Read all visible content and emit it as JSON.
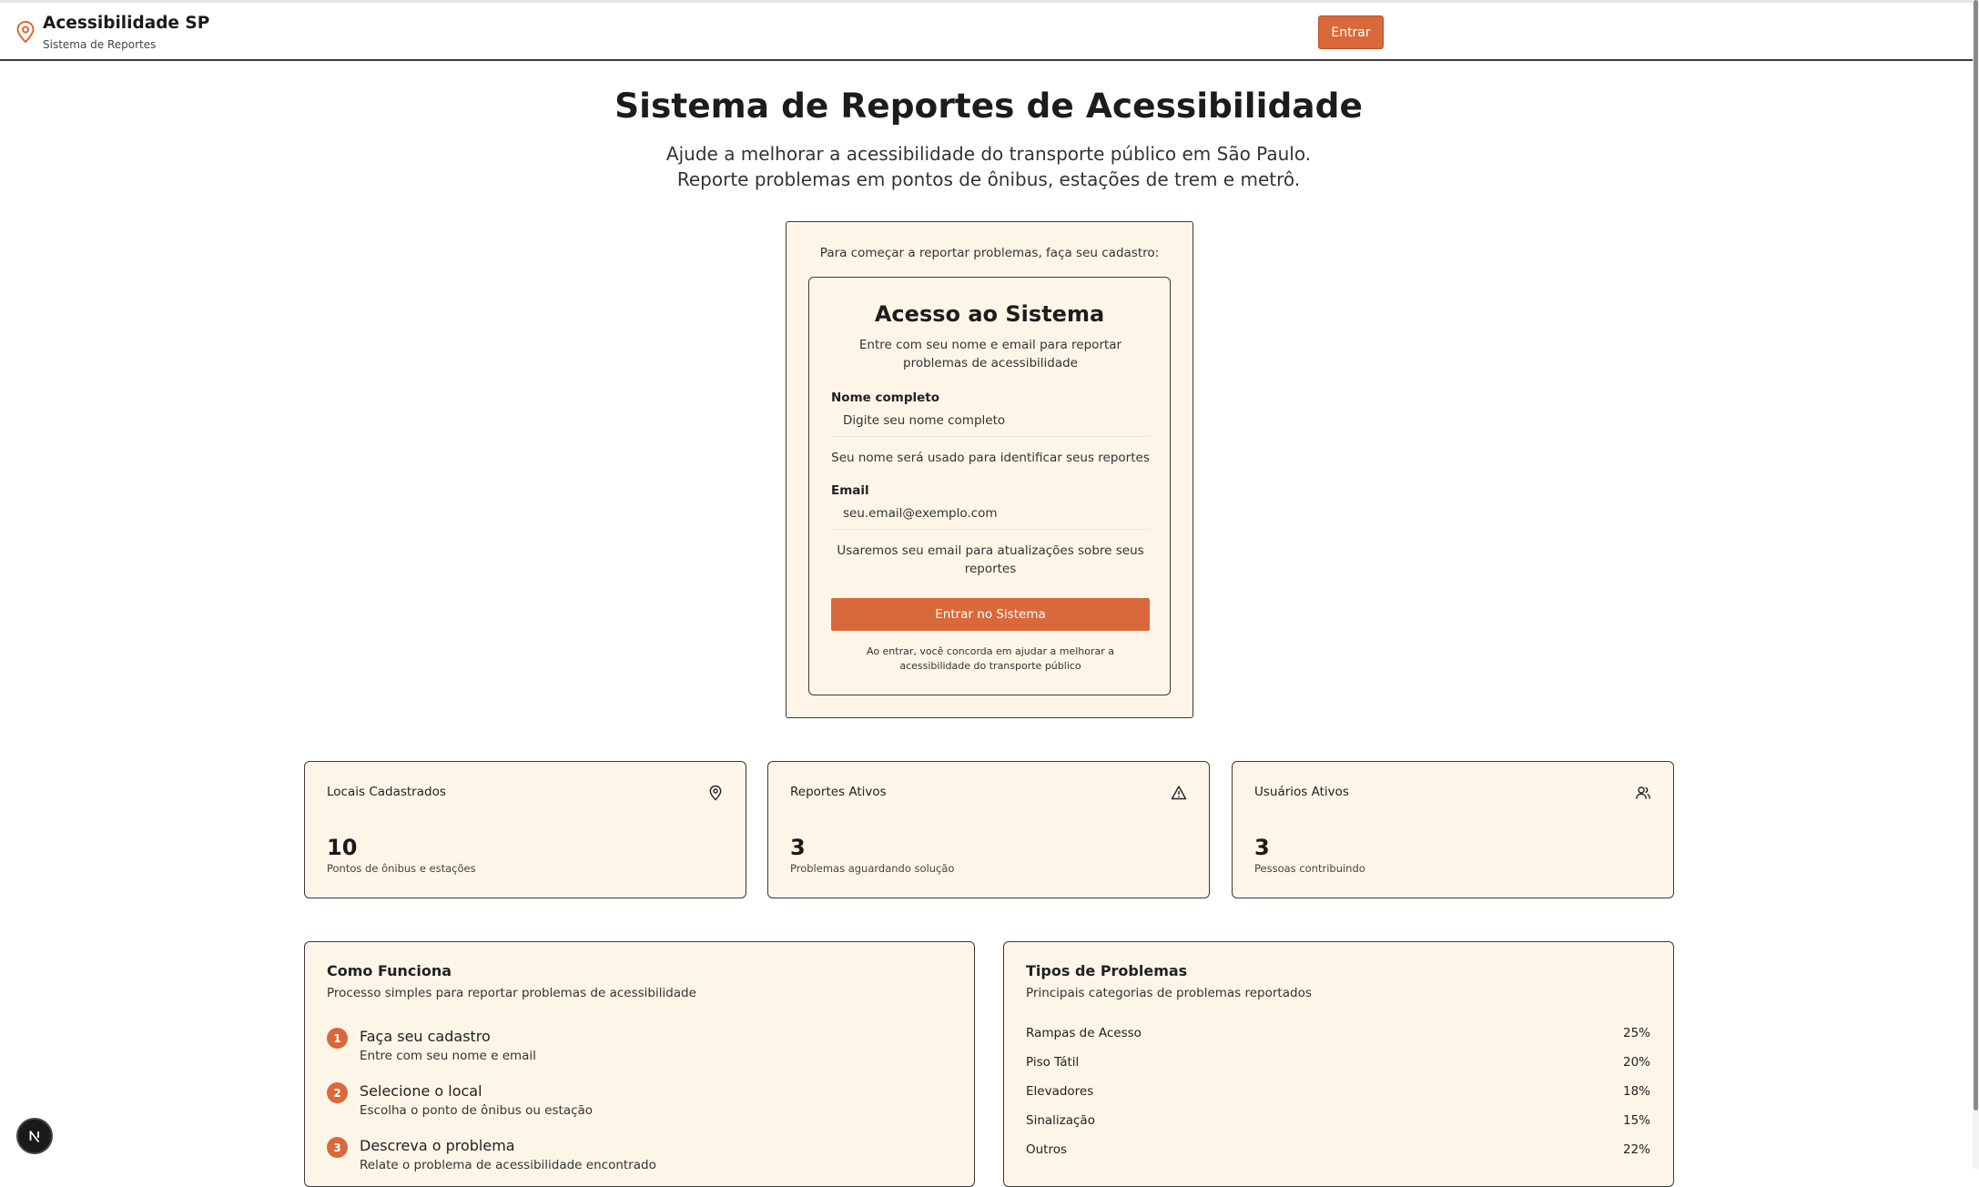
{
  "header": {
    "brand_title": "Acessibilidade SP",
    "brand_subtitle": "Sistema de Reportes",
    "login_label": "Entrar"
  },
  "hero": {
    "title": "Sistema de Reportes de Acessibilidade",
    "line1": "Ajude a melhorar a acessibilidade do transporte público em São Paulo.",
    "line2": "Reporte problemas em pontos de ônibus, estações de trem e metrô."
  },
  "login_panel": {
    "intro": "Para começar a reportar problemas, faça seu cadastro:",
    "card_title": "Acesso ao Sistema",
    "card_description": "Entre com seu nome e email para reportar problemas de acessibilidade",
    "name_label": "Nome completo",
    "name_placeholder": "Digite seu nome completo",
    "name_help": "Seu nome será usado para identificar seus reportes",
    "email_label": "Email",
    "email_placeholder": "seu.email@exemplo.com",
    "email_help": "Usaremos seu email para atualizações sobre seus reportes",
    "submit_label": "Entrar no Sistema",
    "terms": "Ao entrar, você concorda em ajudar a melhorar a acessibilidade do transporte público"
  },
  "stats": [
    {
      "title": "Locais Cadastrados",
      "value": "10",
      "subtitle": "Pontos de ônibus e estações",
      "icon": "map-pin-icon"
    },
    {
      "title": "Reportes Ativos",
      "value": "3",
      "subtitle": "Problemas aguardando solução",
      "icon": "warning-triangle-icon"
    },
    {
      "title": "Usuários Ativos",
      "value": "3",
      "subtitle": "Pessoas contribuindo",
      "icon": "users-icon"
    }
  ],
  "how_it_works": {
    "title": "Como Funciona",
    "subtitle": "Processo simples para reportar problemas de acessibilidade",
    "steps": [
      {
        "number": "1",
        "title": "Faça seu cadastro",
        "description": "Entre com seu nome e email"
      },
      {
        "number": "2",
        "title": "Selecione o local",
        "description": "Escolha o ponto de ônibus ou estação"
      },
      {
        "number": "3",
        "title": "Descreva o problema",
        "description": "Relate o problema de acessibilidade encontrado"
      }
    ]
  },
  "problem_types": {
    "title": "Tipos de Problemas",
    "subtitle": "Principais categorias de problemas reportados",
    "items": [
      {
        "name": "Rampas de Acesso",
        "percent": "25%"
      },
      {
        "name": "Piso Tátil",
        "percent": "20%"
      },
      {
        "name": "Elevadores",
        "percent": "18%"
      },
      {
        "name": "Sinalização",
        "percent": "15%"
      },
      {
        "name": "Outros",
        "percent": "22%"
      }
    ]
  },
  "dev_badge": {
    "letter": "N"
  },
  "colors": {
    "accent": "#d9693a",
    "card_bg": "#fdf5e8",
    "border": "#3a3a3a"
  }
}
